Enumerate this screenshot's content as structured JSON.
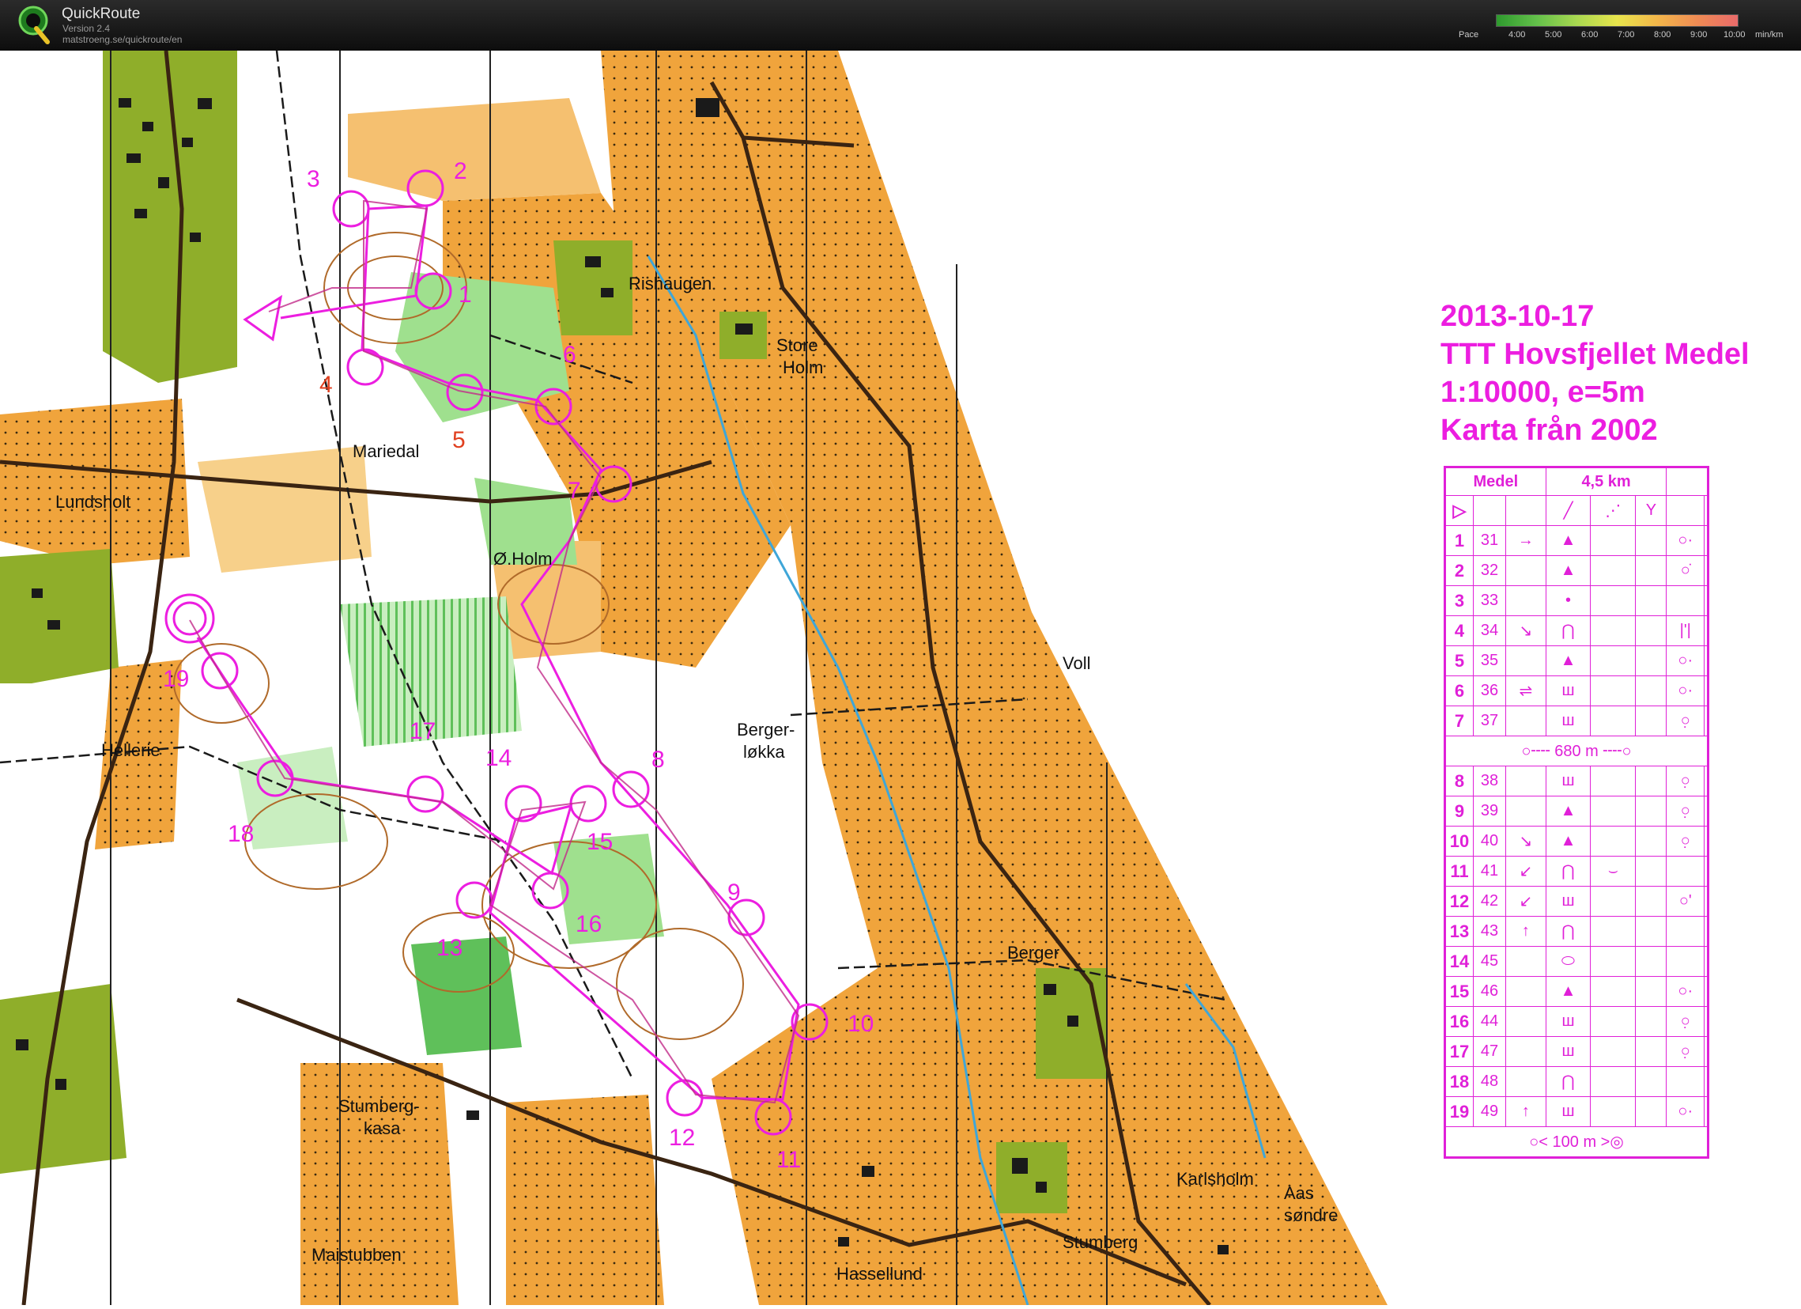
{
  "app": {
    "title": "QuickRoute",
    "version": "Version 2.4",
    "url": "matstroeng.se/quickroute/en",
    "logo_icon": "quickroute-q-logo"
  },
  "pace_legend": {
    "label": "Pace",
    "ticks": [
      "4:00",
      "5:00",
      "6:00",
      "7:00",
      "8:00",
      "9:00",
      "10:00",
      "min/km"
    ],
    "colors": [
      "#2e9a2e",
      "#63c04a",
      "#a9d850",
      "#e7e44c",
      "#f2b64a",
      "#ef8b54",
      "#e86a6a"
    ]
  },
  "map_title": {
    "line1": "2013-10-17",
    "line2": "TTT Hovsfjellet Medel",
    "line3": "1:10000, e=5m",
    "line4": "Karta från 2002"
  },
  "place_names": [
    "Rishaugen",
    "Store",
    "Holm",
    "Mariedal",
    "Lundsholt",
    "Ø.Holm",
    "Voll",
    "Berger-",
    "løkka",
    "Hellerie",
    "Berger",
    "Stumberg-",
    "kasa",
    "Karlsholm",
    "Aas",
    "søndre",
    "Stumberg",
    "Maistubben",
    "Hassellund"
  ],
  "course_numbers": [
    "1",
    "2",
    "3",
    "4",
    "5",
    "6",
    "7",
    "8",
    "9",
    "10",
    "11",
    "12",
    "13",
    "14",
    "15",
    "16",
    "17",
    "18",
    "19"
  ],
  "control_description": {
    "class": "Medel",
    "length": "4,5 km",
    "mid_leg": "680 m",
    "final_leg": "100 m",
    "rows": [
      {
        "n": "1",
        "code": "31",
        "dir": "→",
        "feat": "▲",
        "extra": "",
        "det": "○·"
      },
      {
        "n": "2",
        "code": "32",
        "dir": "",
        "feat": "▲",
        "extra": "",
        "det": "○̇"
      },
      {
        "n": "3",
        "code": "33",
        "dir": "",
        "feat": "•",
        "extra": "",
        "det": ""
      },
      {
        "n": "4",
        "code": "34",
        "dir": "↘",
        "feat": "⋂",
        "extra": "",
        "det": "|'|"
      },
      {
        "n": "5",
        "code": "35",
        "dir": "",
        "feat": "▲",
        "extra": "",
        "det": "○·"
      },
      {
        "n": "6",
        "code": "36",
        "dir": "⇌",
        "feat": "ш",
        "extra": "",
        "det": "○·"
      },
      {
        "n": "7",
        "code": "37",
        "dir": "",
        "feat": "ш",
        "extra": "",
        "det": "○̣"
      },
      {
        "n": "8",
        "code": "38",
        "dir": "",
        "feat": "ш",
        "extra": "",
        "det": "○̣"
      },
      {
        "n": "9",
        "code": "39",
        "dir": "",
        "feat": "▲",
        "extra": "",
        "det": "○̣"
      },
      {
        "n": "10",
        "code": "40",
        "dir": "↘",
        "feat": "▲",
        "extra": "",
        "det": "○̣"
      },
      {
        "n": "11",
        "code": "41",
        "dir": "↙",
        "feat": "⋂",
        "extra": "⌣",
        "det": ""
      },
      {
        "n": "12",
        "code": "42",
        "dir": "↙",
        "feat": "ш",
        "extra": "",
        "det": "○'"
      },
      {
        "n": "13",
        "code": "43",
        "dir": "↑",
        "feat": "⋂",
        "extra": "",
        "det": ""
      },
      {
        "n": "14",
        "code": "45",
        "dir": "",
        "feat": "⬭",
        "extra": "",
        "det": ""
      },
      {
        "n": "15",
        "code": "46",
        "dir": "",
        "feat": "▲",
        "extra": "",
        "det": "○·"
      },
      {
        "n": "16",
        "code": "44",
        "dir": "",
        "feat": "ш",
        "extra": "",
        "det": "○̣"
      },
      {
        "n": "17",
        "code": "47",
        "dir": "",
        "feat": "ш",
        "extra": "",
        "det": "○̣"
      },
      {
        "n": "18",
        "code": "48",
        "dir": "",
        "feat": "⋂",
        "extra": "",
        "det": ""
      },
      {
        "n": "19",
        "code": "49",
        "dir": "↑",
        "feat": "ш",
        "extra": "",
        "det": "○·"
      }
    ]
  }
}
